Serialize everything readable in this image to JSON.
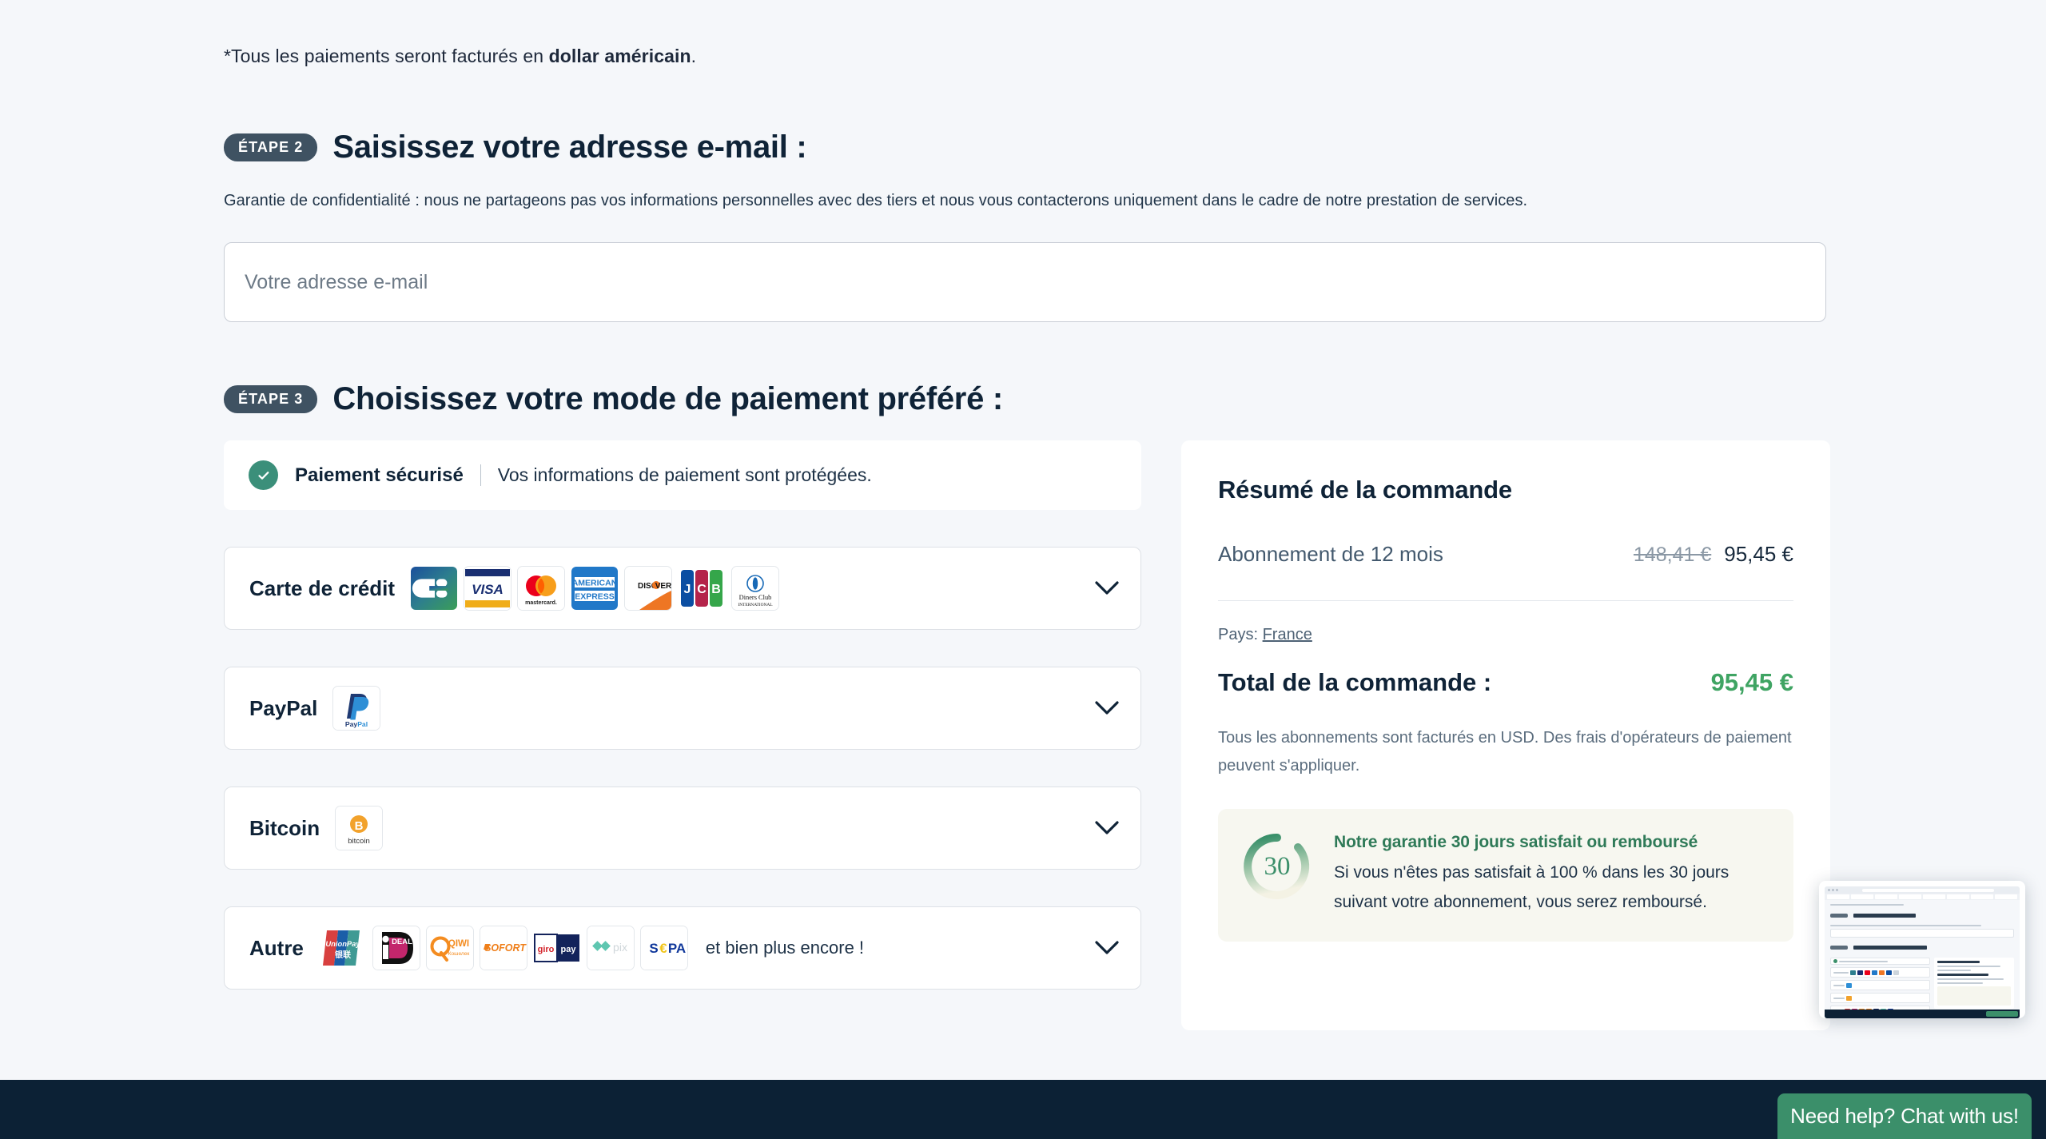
{
  "currency_note": {
    "prefix": "*Tous les paiements seront facturés en ",
    "bold": "dollar américain",
    "suffix": "."
  },
  "step2": {
    "badge": "ÉTAPE 2",
    "title": "Saisissez votre adresse e-mail :",
    "privacy_note": "Garantie de confidentialité : nous ne partageons pas vos informations personnelles avec des tiers et nous vous contacterons uniquement dans le cadre de notre prestation de services.",
    "email_placeholder": "Votre adresse e-mail",
    "email_value": ""
  },
  "step3": {
    "badge": "ÉTAPE 3",
    "title": "Choisissez votre mode de paiement préféré :",
    "secure": {
      "icon": "check-circle-icon",
      "strong": "Paiement sécurisé",
      "text": "Vos informations de paiement sont protégées."
    },
    "methods": [
      {
        "label": "Carte de crédit",
        "logos": [
          "cb-icon",
          "visa-icon",
          "mastercard-icon",
          "amex-icon",
          "discover-icon",
          "jcb-icon",
          "diners-club-icon"
        ],
        "more_text": "",
        "chevron": "chevron-down-icon"
      },
      {
        "label": "PayPal",
        "logos": [
          "paypal-icon"
        ],
        "more_text": "",
        "chevron": "chevron-down-icon"
      },
      {
        "label": "Bitcoin",
        "logos": [
          "bitcoin-icon"
        ],
        "more_text": "",
        "chevron": "chevron-down-icon"
      },
      {
        "label": "Autre",
        "logos": [
          "unionpay-icon",
          "ideal-icon",
          "qiwi-icon",
          "sofort-icon",
          "giropay-icon",
          "pix-icon",
          "sepa-icon"
        ],
        "more_text": "et bien plus encore !",
        "chevron": "chevron-down-icon"
      }
    ]
  },
  "summary": {
    "title": "Résumé de la commande",
    "item_name": "Abonnement de 12 mois",
    "price_old": "148,41 €",
    "price_new": "95,45 €",
    "country_label": "Pays:",
    "country_value": "France",
    "total_label": "Total de la commande :",
    "total_value": "95,45 €",
    "fine_print": "Tous les abonnements sont facturés en USD. Des frais d'opérateurs de paiement peuvent s'appliquer.",
    "guarantee": {
      "badge_number": "30",
      "heading": "Notre garantie 30 jours satisfait ou remboursé",
      "body": "Si vous n'êtes pas satisfait à 100 % dans les 30 jours suivant votre abonnement, vous serez remboursé."
    }
  },
  "chat": {
    "label": "Need help? Chat with us!"
  },
  "colors": {
    "page_bg": "#f5f7fa",
    "text_dark": "#0f2337",
    "badge_bg": "#3f5262",
    "green": "#3b8f6a",
    "total_green": "#3fa463",
    "footer": "#0c2135"
  }
}
